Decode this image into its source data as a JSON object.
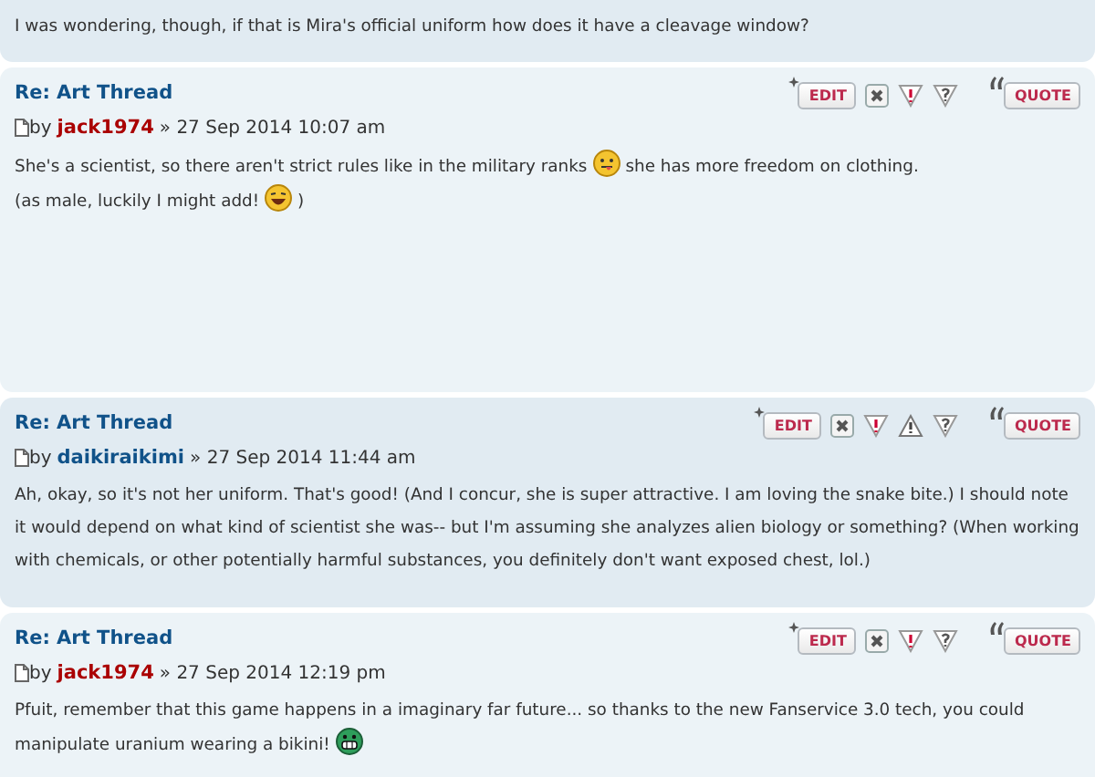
{
  "posts": [
    {
      "kind": "excerpt",
      "body": [
        [
          {
            "kind": "text",
            "text": "I was wondering, though, if that is Mira's official uniform how does it have a cleavage window?"
          }
        ]
      ]
    },
    {
      "kind": "post",
      "title": "Re: Art Thread",
      "by": "by",
      "author": {
        "name": "jack1974",
        "color": "#aa0000"
      },
      "date": "» 27 Sep 2014 10:07 am",
      "buttons": [
        {
          "kind": "edit",
          "label": "EDIT"
        },
        {
          "kind": "delete"
        },
        {
          "kind": "report"
        },
        {
          "kind": "info"
        },
        {
          "kind": "quote",
          "label": "QUOTE"
        }
      ],
      "body": [
        [
          {
            "kind": "text",
            "text": "She's a scientist, so there aren't strict rules like in the military ranks"
          },
          {
            "kind": "tongue"
          },
          {
            "kind": "text",
            "text": "she has more freedom on clothing."
          }
        ],
        [
          {
            "kind": "text",
            "text": "(as male, luckily I might add!"
          },
          {
            "kind": "laugh"
          },
          {
            "kind": "text",
            "text": ")"
          }
        ]
      ]
    },
    {
      "kind": "post",
      "title": "Re: Art Thread",
      "by": "by",
      "author": {
        "name": "daikiraikimi",
        "color": "#105289"
      },
      "date": "» 27 Sep 2014 11:44 am",
      "buttons": [
        {
          "kind": "edit",
          "label": "EDIT"
        },
        {
          "kind": "delete"
        },
        {
          "kind": "report"
        },
        {
          "kind": "warn"
        },
        {
          "kind": "info"
        },
        {
          "kind": "quote",
          "label": "QUOTE"
        }
      ],
      "body": [
        [
          {
            "kind": "text",
            "text": "Ah, okay, so it's not her uniform. That's good! (And I concur, she is super attractive. I am loving the snake bite.) I should note it would depend on what kind of scientist she was-- but I'm assuming she analyzes alien biology or something? (When working with chemicals, or other potentially harmful substances, you definitely don't want exposed chest, lol.)"
          }
        ]
      ]
    },
    {
      "kind": "post",
      "title": "Re: Art Thread",
      "by": "by",
      "author": {
        "name": "jack1974",
        "color": "#aa0000"
      },
      "date": "» 27 Sep 2014 12:19 pm",
      "buttons": [
        {
          "kind": "edit",
          "label": "EDIT"
        },
        {
          "kind": "delete"
        },
        {
          "kind": "report"
        },
        {
          "kind": "info"
        },
        {
          "kind": "quote",
          "label": "QUOTE"
        }
      ],
      "body": [
        [
          {
            "kind": "text",
            "text": "Pfuit, remember that this game happens in a imaginary far future... so thanks to the new Fanservice 3.0 tech, you could"
          }
        ],
        [
          {
            "kind": "text",
            "text": "manipulate uranium wearing a bikini!"
          },
          {
            "kind": "grin"
          }
        ]
      ]
    }
  ]
}
